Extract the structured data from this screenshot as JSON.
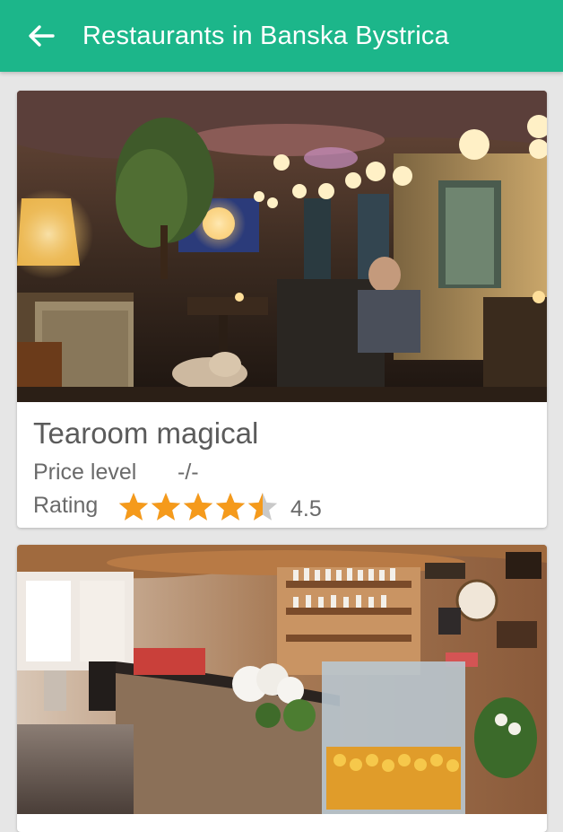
{
  "app_bar": {
    "title": "Restaurants in Banska Bystrica",
    "back_icon": "arrow-left-icon",
    "color": "#1cb68a"
  },
  "restaurants": [
    {
      "name": "Tearoom magical",
      "price_label": "Price level",
      "price_value": "-/-",
      "rating_label": "Rating",
      "rating": 4.5,
      "rating_text": "4.5",
      "star_color": "#f59a1b"
    },
    {
      "photo": "cafe-bar-counter-photo"
    }
  ]
}
